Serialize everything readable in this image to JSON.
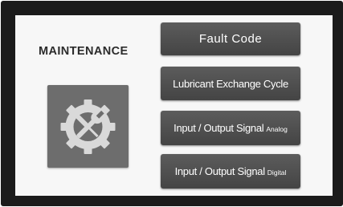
{
  "screen": {
    "title": "MAINTENANCE",
    "icon": "wrench-gear-icon"
  },
  "buttons": [
    {
      "label": "Fault Code",
      "sub": ""
    },
    {
      "label": "Lubricant Exchange Cycle",
      "sub": ""
    },
    {
      "label": "Input / Output Signal",
      "sub": "Analog"
    },
    {
      "label": "Input / Output Signal",
      "sub": "Digital"
    }
  ],
  "colors": {
    "bezel": "#1b1b1b",
    "screen_bg": "#f7f7f7",
    "button_bg": "#505050",
    "tile_bg": "#6d6d6d",
    "text_light": "#ffffff",
    "text_dark": "#2b2b2b"
  }
}
